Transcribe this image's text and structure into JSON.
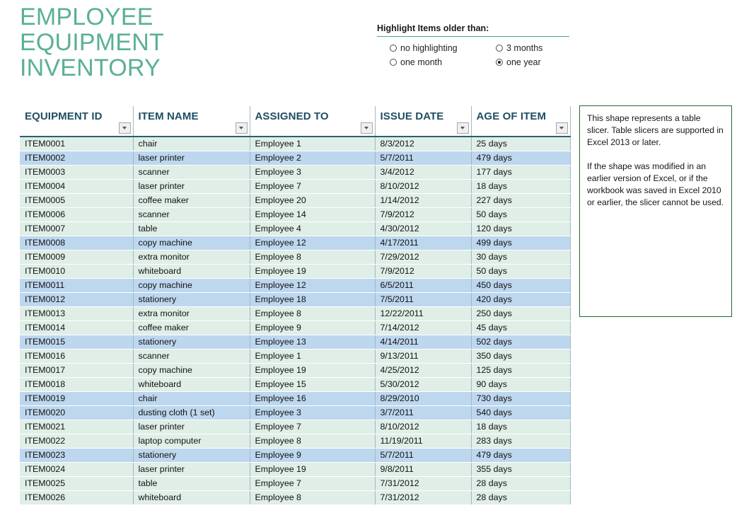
{
  "title": {
    "lines": [
      "EMPLOYEE",
      "EQUIPMENT",
      "INVENTORY"
    ],
    "color": "#5bb094"
  },
  "slicer": {
    "title": "Highlight Items older than:",
    "options": [
      {
        "label": "no highlighting",
        "selected": false
      },
      {
        "label": "3 months",
        "selected": false
      },
      {
        "label": "one month",
        "selected": false
      },
      {
        "label": "one year",
        "selected": true
      }
    ]
  },
  "table": {
    "columns": [
      "EQUIPMENT ID",
      "ITEM NAME",
      "ASSIGNED TO",
      "ISSUE DATE",
      "AGE OF ITEM"
    ],
    "filter_icon": "filter-dropdown-icon",
    "header_color": "#1f4e63",
    "row_color": "#dfeee7",
    "highlight_color": "#bdd7ee",
    "rows": [
      {
        "id": "ITEM0001",
        "item": "chair",
        "assigned": "Employee 1",
        "issued": "8/3/2012",
        "age": "25 days",
        "highlight": false
      },
      {
        "id": "ITEM0002",
        "item": "laser printer",
        "assigned": "Employee 2",
        "issued": "5/7/2011",
        "age": "479 days",
        "highlight": true
      },
      {
        "id": "ITEM0003",
        "item": "scanner",
        "assigned": "Employee 3",
        "issued": "3/4/2012",
        "age": "177 days",
        "highlight": false
      },
      {
        "id": "ITEM0004",
        "item": "laser printer",
        "assigned": "Employee 7",
        "issued": "8/10/2012",
        "age": "18 days",
        "highlight": false
      },
      {
        "id": "ITEM0005",
        "item": "coffee maker",
        "assigned": "Employee 20",
        "issued": "1/14/2012",
        "age": "227 days",
        "highlight": false
      },
      {
        "id": "ITEM0006",
        "item": "scanner",
        "assigned": "Employee 14",
        "issued": "7/9/2012",
        "age": "50 days",
        "highlight": false
      },
      {
        "id": "ITEM0007",
        "item": "table",
        "assigned": "Employee 4",
        "issued": "4/30/2012",
        "age": "120 days",
        "highlight": false
      },
      {
        "id": "ITEM0008",
        "item": "copy machine",
        "assigned": "Employee 12",
        "issued": "4/17/2011",
        "age": "499 days",
        "highlight": true
      },
      {
        "id": "ITEM0009",
        "item": "extra monitor",
        "assigned": "Employee 8",
        "issued": "7/29/2012",
        "age": "30 days",
        "highlight": false
      },
      {
        "id": "ITEM0010",
        "item": "whiteboard",
        "assigned": "Employee 19",
        "issued": "7/9/2012",
        "age": "50 days",
        "highlight": false
      },
      {
        "id": "ITEM0011",
        "item": "copy machine",
        "assigned": "Employee 12",
        "issued": "6/5/2011",
        "age": "450 days",
        "highlight": true
      },
      {
        "id": "ITEM0012",
        "item": "stationery",
        "assigned": "Employee 18",
        "issued": "7/5/2011",
        "age": "420 days",
        "highlight": true
      },
      {
        "id": "ITEM0013",
        "item": "extra monitor",
        "assigned": "Employee 8",
        "issued": "12/22/2011",
        "age": "250 days",
        "highlight": false
      },
      {
        "id": "ITEM0014",
        "item": "coffee maker",
        "assigned": "Employee 9",
        "issued": "7/14/2012",
        "age": "45 days",
        "highlight": false
      },
      {
        "id": "ITEM0015",
        "item": "stationery",
        "assigned": "Employee 13",
        "issued": "4/14/2011",
        "age": "502 days",
        "highlight": true
      },
      {
        "id": "ITEM0016",
        "item": "scanner",
        "assigned": "Employee 1",
        "issued": "9/13/2011",
        "age": "350 days",
        "highlight": false
      },
      {
        "id": "ITEM0017",
        "item": "copy machine",
        "assigned": "Employee 19",
        "issued": "4/25/2012",
        "age": "125 days",
        "highlight": false
      },
      {
        "id": "ITEM0018",
        "item": "whiteboard",
        "assigned": "Employee 15",
        "issued": "5/30/2012",
        "age": "90 days",
        "highlight": false
      },
      {
        "id": "ITEM0019",
        "item": "chair",
        "assigned": "Employee 16",
        "issued": "8/29/2010",
        "age": "730 days",
        "highlight": true
      },
      {
        "id": "ITEM0020",
        "item": "dusting cloth (1 set)",
        "assigned": "Employee 3",
        "issued": "3/7/2011",
        "age": "540 days",
        "highlight": true
      },
      {
        "id": "ITEM0021",
        "item": "laser printer",
        "assigned": "Employee 7",
        "issued": "8/10/2012",
        "age": "18 days",
        "highlight": false
      },
      {
        "id": "ITEM0022",
        "item": "laptop computer",
        "assigned": "Employee 8",
        "issued": "11/19/2011",
        "age": "283 days",
        "highlight": false
      },
      {
        "id": "ITEM0023",
        "item": "stationery",
        "assigned": "Employee 9",
        "issued": "5/7/2011",
        "age": "479 days",
        "highlight": true
      },
      {
        "id": "ITEM0024",
        "item": "laser printer",
        "assigned": "Employee 19",
        "issued": "9/8/2011",
        "age": "355 days",
        "highlight": false
      },
      {
        "id": "ITEM0025",
        "item": "table",
        "assigned": "Employee 7",
        "issued": "7/31/2012",
        "age": "28 days",
        "highlight": false
      },
      {
        "id": "ITEM0026",
        "item": "whiteboard",
        "assigned": "Employee 8",
        "issued": "7/31/2012",
        "age": "28 days",
        "highlight": false
      }
    ]
  },
  "note": {
    "border_color": "#1e6b33",
    "paragraphs": [
      "This shape represents a table slicer. Table slicers are supported in Excel 2013 or later.",
      "If the shape was modified in an earlier version of Excel, or if the workbook was saved in Excel 2010 or earlier, the slicer cannot be used."
    ]
  }
}
